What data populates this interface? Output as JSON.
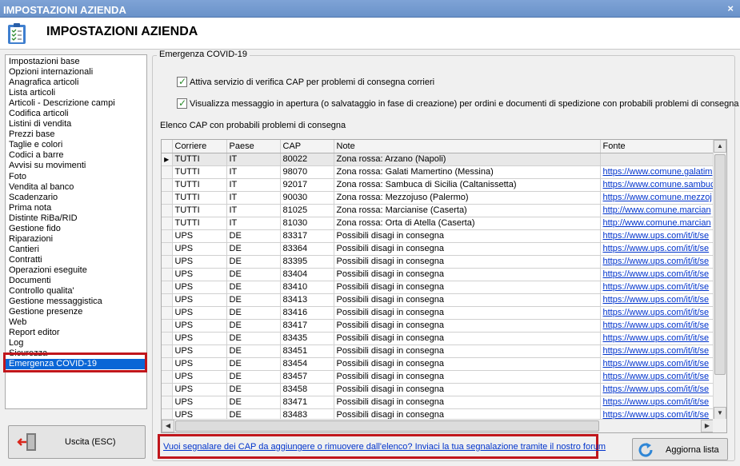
{
  "window": {
    "title": "IMPOSTAZIONI AZIENDA",
    "close": "×"
  },
  "header": {
    "title": "IMPOSTAZIONI AZIENDA",
    "icon": "clipboard-checklist-icon"
  },
  "sidebar": {
    "items": [
      "Impostazioni base",
      "Opzioni internazionali",
      "Anagrafica articoli",
      "Lista articoli",
      "Articoli - Descrizione campi",
      "Codifica articoli",
      "Listini di vendita",
      "Prezzi base",
      "Taglie e colori",
      "Codici a barre",
      "Avvisi su movimenti",
      "Foto",
      "Vendita al banco",
      "Scadenzario",
      "Prima nota",
      "Distinte RiBa/RID",
      "Gestione fido",
      "Riparazioni",
      "Cantieri",
      "Contratti",
      "Operazioni eseguite",
      "Documenti",
      "Controllo qualita'",
      "Gestione messaggistica",
      "Gestione presenze",
      "Web",
      "Report editor",
      "Log",
      "Sicurezza",
      "Emergenza COVID-19"
    ],
    "selected_index": 29
  },
  "exit_button": {
    "label": "Uscita (ESC)",
    "icon": "exit-door-icon"
  },
  "group": {
    "title": "Emergenza COVID-19",
    "check1": {
      "checked": true,
      "label": "Attiva servizio di verifica CAP per problemi di consegna corrieri"
    },
    "check2": {
      "checked": true,
      "label": "Visualizza messaggio in apertura (o salvataggio in fase di creazione) per ordini e documenti di spedizione con probabili problemi di consegna"
    },
    "list_label": "Elenco CAP con probabili problemi di consegna"
  },
  "grid": {
    "columns": [
      "Corriere",
      "Paese",
      "CAP",
      "Note",
      "Fonte"
    ],
    "current_row": 0,
    "rows": [
      [
        "TUTTI",
        "IT",
        "80022",
        "Zona rossa: Arzano (Napoli)",
        ""
      ],
      [
        "TUTTI",
        "IT",
        "98070",
        "Zona rossa: Galati Mamertino (Messina)",
        "https://www.comune.galatim"
      ],
      [
        "TUTTI",
        "IT",
        "92017",
        "Zona rossa: Sambuca di Sicilia (Caltanissetta)",
        "https://www.comune.sambuc"
      ],
      [
        "TUTTI",
        "IT",
        "90030",
        "Zona rossa: Mezzojuso (Palermo)",
        "https://www.comune.mezzoj"
      ],
      [
        "TUTTI",
        "IT",
        "81025",
        "Zona rossa: Marcianise (Caserta)",
        "http://www.comune.marcian"
      ],
      [
        "TUTTI",
        "IT",
        "81030",
        "Zona rossa: Orta di Atella (Caserta)",
        "http://www.comune.marcian"
      ],
      [
        "UPS",
        "DE",
        "83317",
        "Possibili disagi in consegna",
        "https://www.ups.com/it/it/se"
      ],
      [
        "UPS",
        "DE",
        "83364",
        "Possibili disagi in consegna",
        "https://www.ups.com/it/it/se"
      ],
      [
        "UPS",
        "DE",
        "83395",
        "Possibili disagi in consegna",
        "https://www.ups.com/it/it/se"
      ],
      [
        "UPS",
        "DE",
        "83404",
        "Possibili disagi in consegna",
        "https://www.ups.com/it/it/se"
      ],
      [
        "UPS",
        "DE",
        "83410",
        "Possibili disagi in consegna",
        "https://www.ups.com/it/it/se"
      ],
      [
        "UPS",
        "DE",
        "83413",
        "Possibili disagi in consegna",
        "https://www.ups.com/it/it/se"
      ],
      [
        "UPS",
        "DE",
        "83416",
        "Possibili disagi in consegna",
        "https://www.ups.com/it/it/se"
      ],
      [
        "UPS",
        "DE",
        "83417",
        "Possibili disagi in consegna",
        "https://www.ups.com/it/it/se"
      ],
      [
        "UPS",
        "DE",
        "83435",
        "Possibili disagi in consegna",
        "https://www.ups.com/it/it/se"
      ],
      [
        "UPS",
        "DE",
        "83451",
        "Possibili disagi in consegna",
        "https://www.ups.com/it/it/se"
      ],
      [
        "UPS",
        "DE",
        "83454",
        "Possibili disagi in consegna",
        "https://www.ups.com/it/it/se"
      ],
      [
        "UPS",
        "DE",
        "83457",
        "Possibili disagi in consegna",
        "https://www.ups.com/it/it/se"
      ],
      [
        "UPS",
        "DE",
        "83458",
        "Possibili disagi in consegna",
        "https://www.ups.com/it/it/se"
      ],
      [
        "UPS",
        "DE",
        "83471",
        "Possibili disagi in consegna",
        "https://www.ups.com/it/it/se"
      ],
      [
        "UPS",
        "DE",
        "83483",
        "Possibili disagi in consegna",
        "https://www.ups.com/it/it/se"
      ]
    ]
  },
  "forum_link": "Vuoi segnalare dei CAP da aggiungere o rimuovere dall'elenco? Inviaci la tua segnalazione tramite il nostro forum",
  "refresh_button": {
    "label": "Aggiorna lista",
    "icon": "refresh-icon"
  },
  "colors": {
    "titlebar": "#6a92c9",
    "selection": "#0a66d6",
    "highlight_outline": "#c0161c",
    "link": "#0033cc"
  }
}
